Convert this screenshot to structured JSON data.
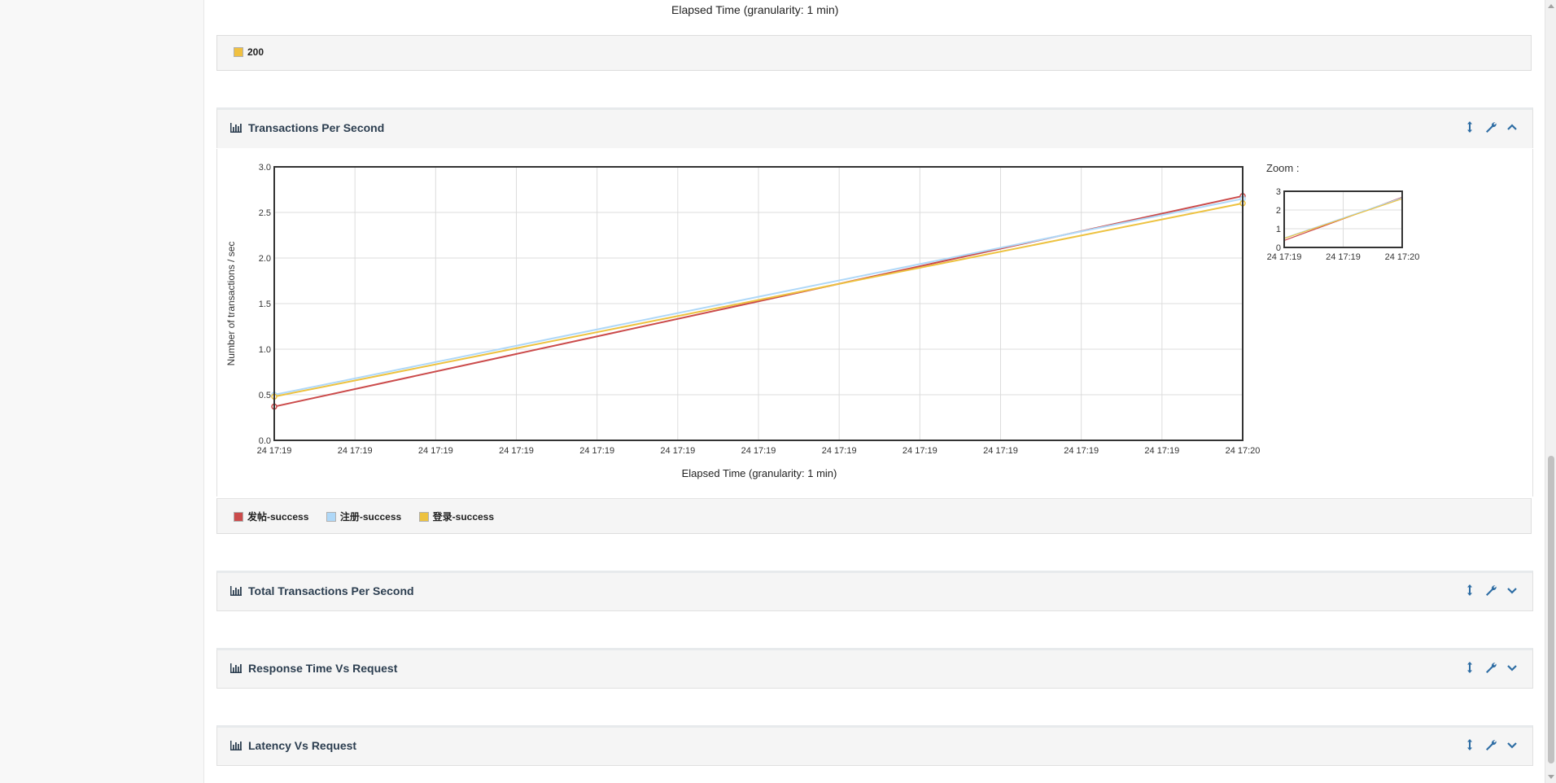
{
  "previous_panel": {
    "caption": "Elapsed Time (granularity: 1 min)",
    "legend": [
      {
        "label": "200",
        "color": "#f0c040"
      }
    ]
  },
  "tps_panel": {
    "title": "Transactions Per Second",
    "zoom_label": "Zoom :",
    "legend": [
      {
        "label": "发帖-success",
        "color": "#cb4b4b"
      },
      {
        "label": "注册-success",
        "color": "#afd8f8"
      },
      {
        "label": "登录-success",
        "color": "#edc240"
      }
    ]
  },
  "collapsed_panels": [
    {
      "title": "Total Transactions Per Second"
    },
    {
      "title": "Response Time Vs Request"
    },
    {
      "title": "Latency Vs Request"
    }
  ],
  "icons": {
    "panel": "bar-chart-icon",
    "tools": [
      "resize-vertical-icon",
      "wrench-icon",
      "chevron-icon"
    ]
  },
  "chart_data": {
    "type": "line",
    "title": "",
    "xlabel": "Elapsed Time (granularity: 1 min)",
    "ylabel": "Number of transactions / sec",
    "ylim": [
      0,
      3
    ],
    "yticks": [
      "0.0",
      "0.5",
      "1.0",
      "1.5",
      "2.0",
      "2.5",
      "3.0"
    ],
    "xticks": [
      "24 17:19",
      "24 17:19",
      "24 17:19",
      "24 17:19",
      "24 17:19",
      "24 17:19",
      "24 17:19",
      "24 17:19",
      "24 17:19",
      "24 17:19",
      "24 17:19",
      "24 17:19",
      "24 17:20"
    ],
    "x": [
      "24 17:19",
      "24 17:20"
    ],
    "grid": true,
    "legend_position": "bottom",
    "series": [
      {
        "name": "发帖-success",
        "color": "#cb4b4b",
        "values": [
          0.37,
          2.68
        ]
      },
      {
        "name": "注册-success",
        "color": "#afd8f8",
        "values": [
          0.5,
          2.65
        ]
      },
      {
        "name": "登录-success",
        "color": "#edc240",
        "values": [
          0.48,
          2.6
        ]
      }
    ],
    "zoom": {
      "yticks": [
        "0",
        "1",
        "2",
        "3"
      ],
      "xticks": [
        "24 17:19",
        "24 17:19",
        "24 17:20"
      ],
      "ylim": [
        0,
        3
      ]
    }
  }
}
